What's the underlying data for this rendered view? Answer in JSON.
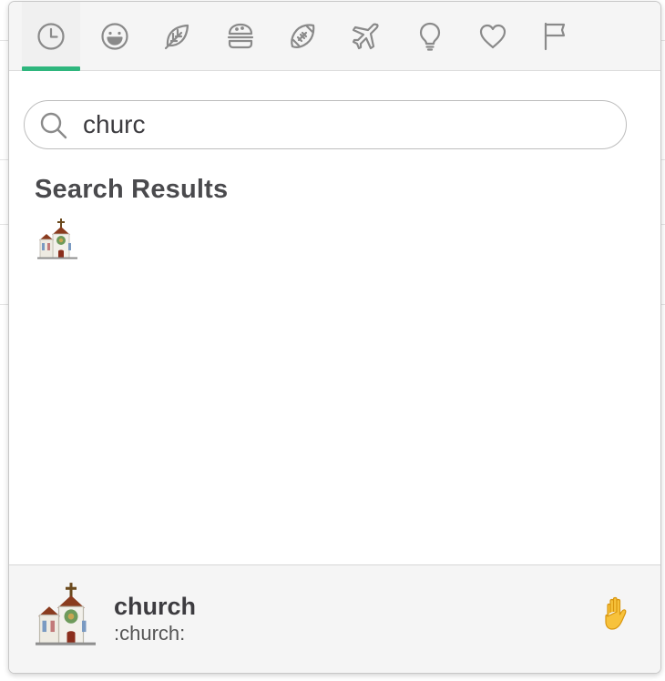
{
  "tabs": [
    {
      "id": "recent",
      "icon": "clock-icon",
      "active": true
    },
    {
      "id": "people",
      "icon": "smiley-icon",
      "active": false
    },
    {
      "id": "nature",
      "icon": "leaf-icon",
      "active": false
    },
    {
      "id": "food",
      "icon": "burger-icon",
      "active": false
    },
    {
      "id": "activity",
      "icon": "football-icon",
      "active": false
    },
    {
      "id": "travel",
      "icon": "airplane-icon",
      "active": false
    },
    {
      "id": "objects",
      "icon": "lightbulb-icon",
      "active": false
    },
    {
      "id": "symbols",
      "icon": "heart-icon",
      "active": false
    },
    {
      "id": "flags",
      "icon": "flag-icon",
      "active": false
    }
  ],
  "colors": {
    "accent": "#2eb67d",
    "icon": "#8a8a8a",
    "text": "#3d3c40"
  },
  "search": {
    "value": "churc",
    "icon": "search-icon"
  },
  "results": {
    "heading": "Search Results",
    "items": [
      {
        "name": "church",
        "icon": "church-emoji"
      }
    ]
  },
  "preview": {
    "name": "church",
    "code": ":church:",
    "icon": "church-emoji"
  },
  "skin_tone": {
    "icon": "raised-hand-emoji"
  }
}
